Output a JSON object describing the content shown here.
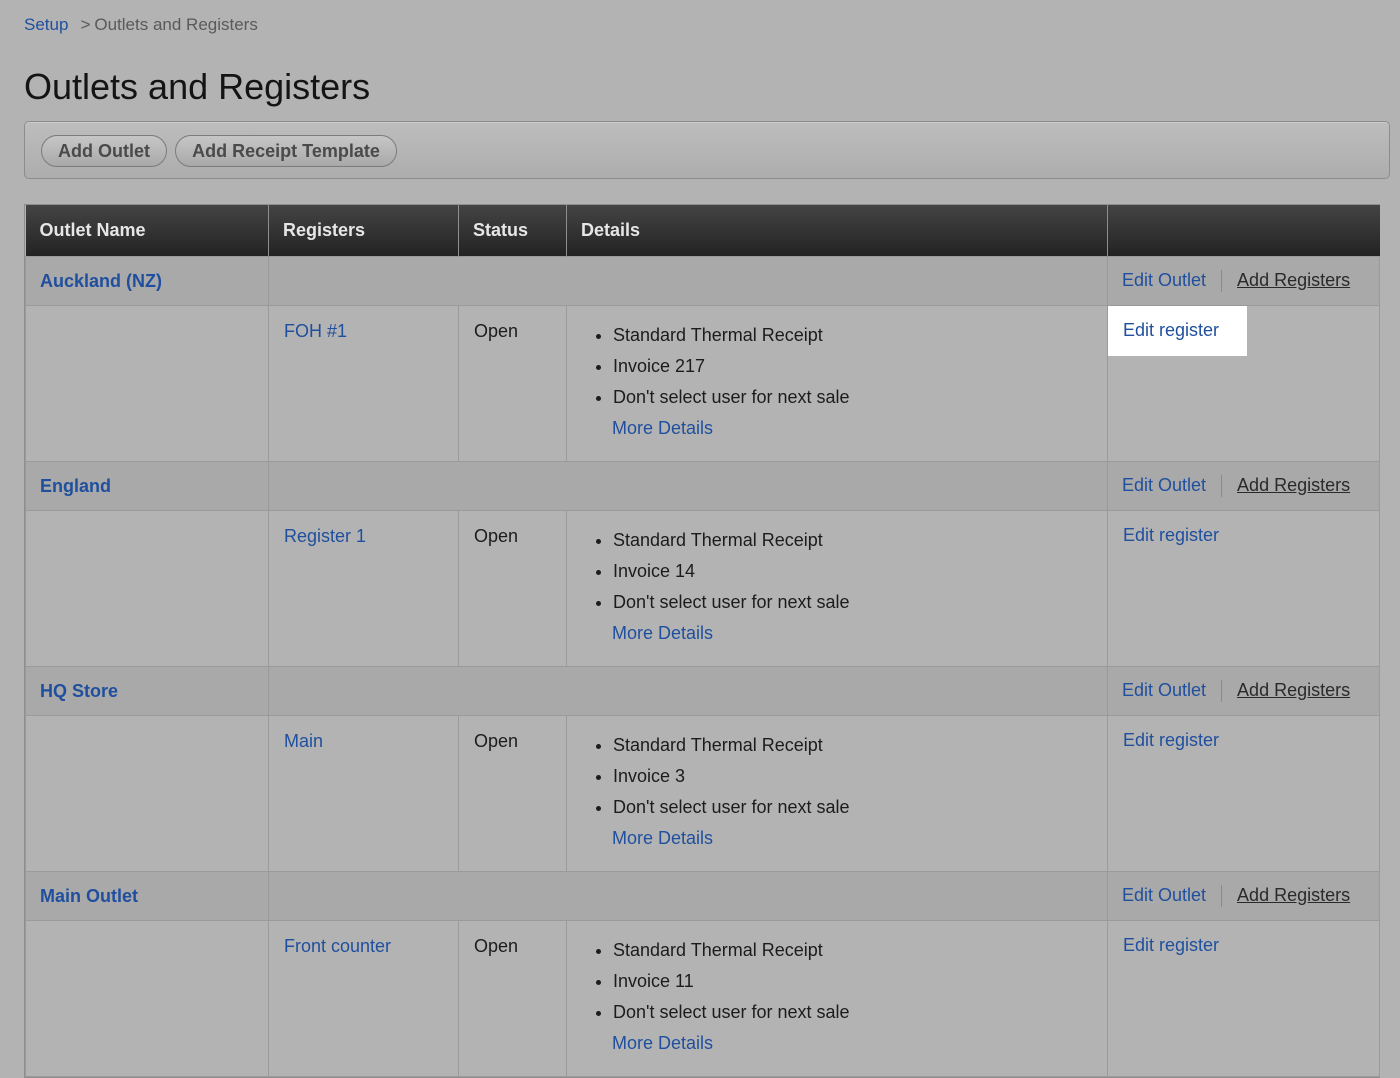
{
  "breadcrumb": {
    "root": "Setup",
    "separator": ">",
    "current": "Outlets and Registers"
  },
  "page": {
    "title": "Outlets and Registers"
  },
  "toolbar": {
    "add_outlet": "Add Outlet",
    "add_receipt_template": "Add Receipt Template"
  },
  "table": {
    "headers": [
      "Outlet Name",
      "Registers",
      "Status",
      "Details",
      ""
    ],
    "actions": {
      "edit_outlet": "Edit Outlet",
      "add_registers": "Add Registers",
      "edit_register": "Edit register",
      "more_details": "More Details"
    },
    "outlets": [
      {
        "name": "Auckland (NZ)",
        "register": {
          "name": "FOH #1",
          "status": "Open",
          "details": [
            "Standard Thermal Receipt",
            "Invoice 217",
            "Don't select user for next sale"
          ]
        }
      },
      {
        "name": "England",
        "register": {
          "name": "Register 1",
          "status": "Open",
          "details": [
            "Standard Thermal Receipt",
            "Invoice 14",
            "Don't select user for next sale"
          ]
        }
      },
      {
        "name": "HQ Store",
        "register": {
          "name": "Main",
          "status": "Open",
          "details": [
            "Standard Thermal Receipt",
            "Invoice 3",
            "Don't select user for next sale"
          ]
        }
      },
      {
        "name": "Main Outlet",
        "register": {
          "name": "Front counter",
          "status": "Open",
          "details": [
            "Standard Thermal Receipt",
            "Invoice 11",
            "Don't select user for next sale"
          ]
        }
      }
    ]
  }
}
